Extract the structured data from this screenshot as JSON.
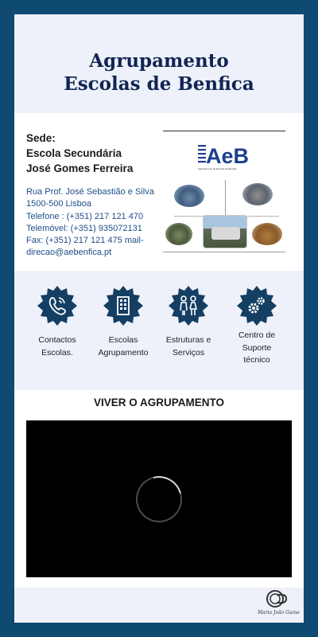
{
  "header": {
    "title_line1": "Agrupamento",
    "title_line2": "Escolas de Benfica"
  },
  "sede": {
    "heading_line1": "Sede:",
    "heading_line2": "Escola Secundária",
    "heading_line3": "José Gomes Ferreira",
    "address_line1": "Rua Prof. José Sebastião e Silva",
    "address_line2": "1500-500 Lisboa",
    "phone": "Telefone : (+351) 217 121 470",
    "mobile": "Telemóvel: (+351) 935072131",
    "fax": " Fax: (+351) 217 121 475 mail-",
    "email": "direcao@aebenfica.pt",
    "logo_text": "AeB",
    "logo_subtitle": "Agrupamento de Escolas de Benfica"
  },
  "services": [
    {
      "label_line1": "Contactos",
      "label_line2": "Escolas.",
      "icon": "phone-icon"
    },
    {
      "label_line1": "Escolas",
      "label_line2": "Agrupamento",
      "icon": "building-icon"
    },
    {
      "label_line1": "Estruturas e",
      "label_line2": "Serviços",
      "icon": "people-icon"
    },
    {
      "label_line1": "Centro de Suporte",
      "label_line2": "técnico",
      "icon": "gears-icon"
    }
  ],
  "video": {
    "title": "VIVER O AGRUPAMENTO"
  },
  "footer": {
    "signature": "Maria João Gama"
  },
  "colors": {
    "background": "#0f4a72",
    "title": "#102553",
    "badge": "#153e63",
    "contact_text": "#1d4f89",
    "panel": "#eef1f9"
  }
}
